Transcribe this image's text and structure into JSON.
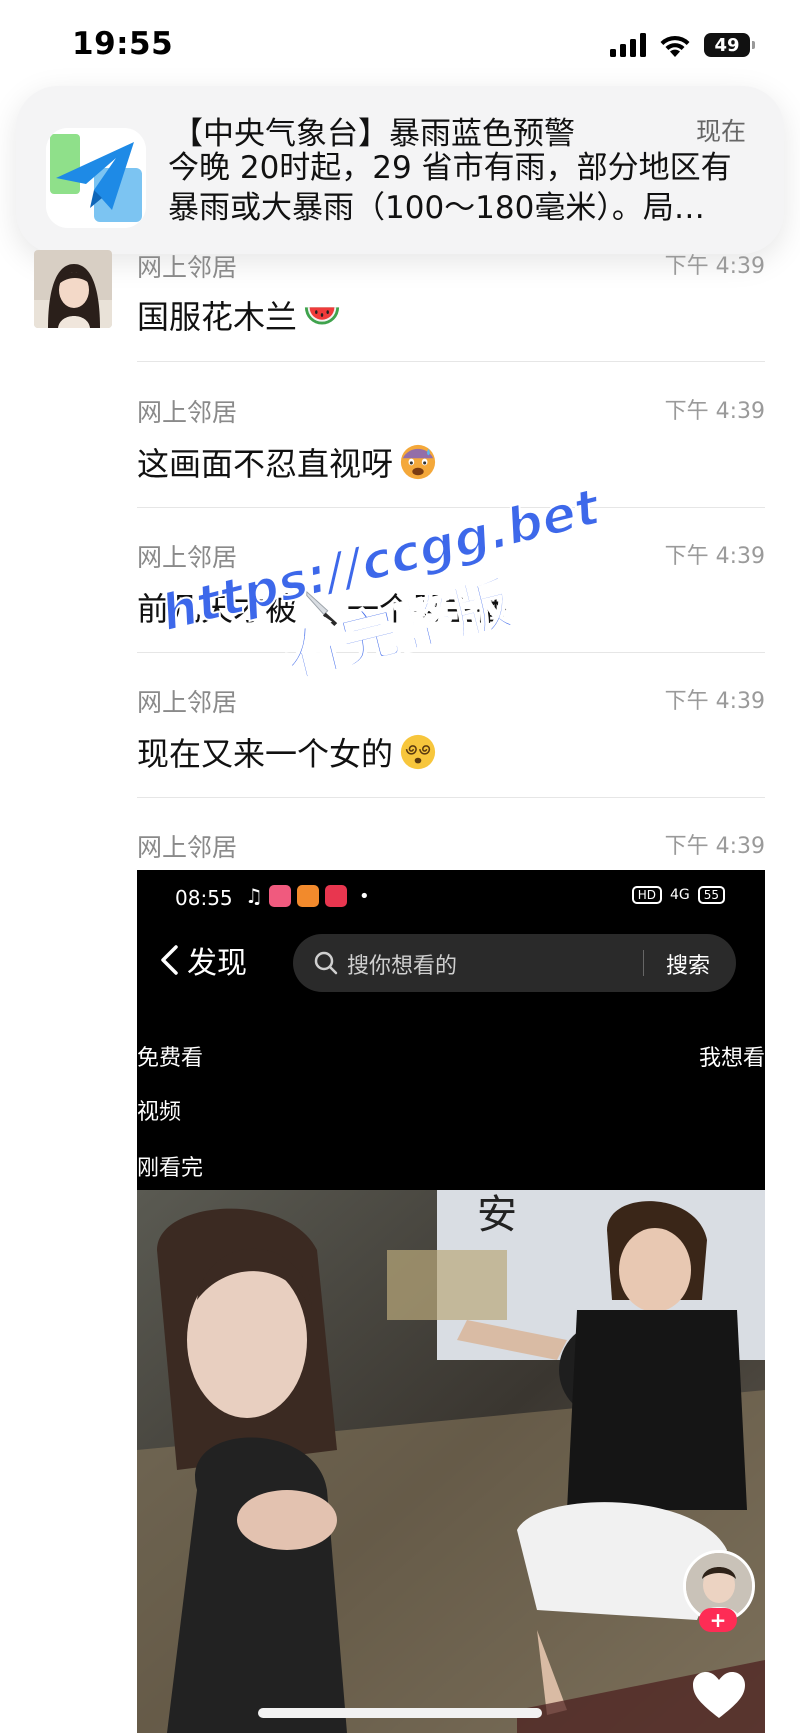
{
  "status_bar": {
    "time": "19:55",
    "battery": "49",
    "icons": [
      "signal-icon",
      "wifi-icon",
      "battery-icon"
    ]
  },
  "notification": {
    "app_icon": "paper-plane-icon",
    "title": "【中央气象台】暴雨蓝色预警",
    "time": "现在",
    "body_line1": "今晚 20时起，29 省市有雨，部分地区有",
    "body_line2": "暴雨或大暴雨（100～180毫米）。局…"
  },
  "messages": [
    {
      "name": "网上邻居",
      "time": "下午 4:39",
      "text": "国服花木兰",
      "emoji": "watermelon-emoji"
    },
    {
      "name": "网上邻居",
      "time": "下午 4:39",
      "text": "这画面不忍直视呀",
      "emoji": "fearful-face-emoji"
    },
    {
      "name": "网上邻居",
      "time": "下午 4:39",
      "text_before": "前几天才被",
      "text_after": "一个男主播",
      "emoji": "knife-emoji"
    },
    {
      "name": "网上邻居",
      "time": "下午 4:39",
      "text": "现在又来一个女的",
      "emoji": "dizzy-face-emoji"
    },
    {
      "name": "网上邻居",
      "time": "下午 4:39"
    }
  ],
  "video_screenshot": {
    "time": "08:55",
    "status_right": "HD",
    "network": "4G",
    "battery": "55",
    "back_label": "发现",
    "search_placeholder": "搜你想看的",
    "search_button": "搜索",
    "free_watch": "免费看",
    "want_watch": "我想看",
    "video_label": "视频",
    "just_watched": "刚看完",
    "sign_text": "安",
    "follow_plus": "+"
  },
  "watermark": {
    "line1": "https://ccgg.bet",
    "line2": "看完整版"
  },
  "colors": {
    "watermark": "#3d68ea",
    "follow_button": "#fe2c55",
    "secondary_text": "#8a8a8a"
  }
}
